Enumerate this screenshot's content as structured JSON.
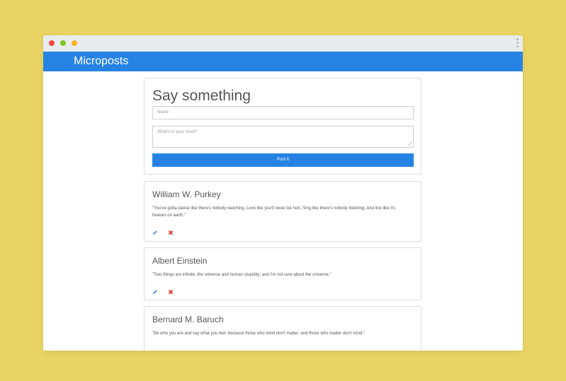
{
  "navbar": {
    "brand": "Microposts"
  },
  "form": {
    "title": "Say something",
    "name_placeholder": "Name",
    "mind_placeholder": "What's in your mind?",
    "submit_label": "Post It"
  },
  "posts": [
    {
      "author": "William W. Purkey",
      "text": "\"You've gotta dance like there's nobody watching, Love like you'll never be hurt, Sing like there's nobody listening, And live like it's heaven on earth.\""
    },
    {
      "author": "Albert Einstein",
      "text": "\"Two things are infinite: the universe and human stupidity; and I'm not sure about the universe.\""
    },
    {
      "author": "Bernard M. Baruch",
      "text": "\"Be who you are and say what you feel, because those who mind don't matter, and those who matter don't mind.\""
    }
  ],
  "colors": {
    "background": "#e9d463",
    "accent": "#2783e3",
    "delete": "#e0301e"
  },
  "icons": {
    "edit": "pencil-icon",
    "delete": "close-icon"
  }
}
